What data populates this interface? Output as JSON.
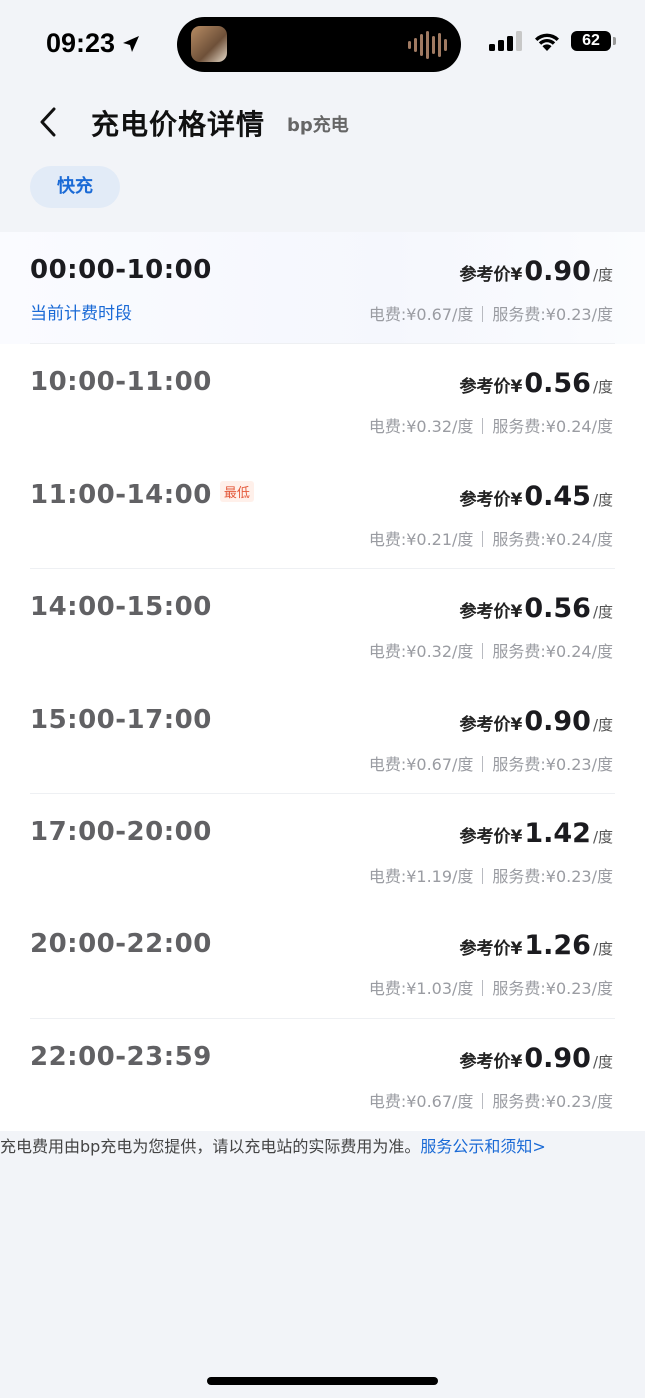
{
  "status_bar": {
    "time": "09:23",
    "battery": "62"
  },
  "header": {
    "title": "充电价格详情",
    "subtitle": "bp充电"
  },
  "tabs": {
    "active_label": "快充"
  },
  "labels": {
    "ref_price": "参考价¥",
    "unit": "/度",
    "current_period": "当前计费时段",
    "lowest_tag": "最低"
  },
  "periods": [
    {
      "period": "00:00-10:00",
      "price": "0.90",
      "electricity": "电费:¥0.67/度",
      "service": "服务费:¥0.23/度"
    },
    {
      "period": "10:00-11:00",
      "price": "0.56",
      "electricity": "电费:¥0.32/度",
      "service": "服务费:¥0.24/度"
    },
    {
      "period": "11:00-14:00",
      "price": "0.45",
      "electricity": "电费:¥0.21/度",
      "service": "服务费:¥0.24/度"
    },
    {
      "period": "14:00-15:00",
      "price": "0.56",
      "electricity": "电费:¥0.32/度",
      "service": "服务费:¥0.24/度"
    },
    {
      "period": "15:00-17:00",
      "price": "0.90",
      "electricity": "电费:¥0.67/度",
      "service": "服务费:¥0.23/度"
    },
    {
      "period": "17:00-20:00",
      "price": "1.42",
      "electricity": "电费:¥1.19/度",
      "service": "服务费:¥0.23/度"
    },
    {
      "period": "20:00-22:00",
      "price": "1.26",
      "electricity": "电费:¥1.03/度",
      "service": "服务费:¥0.23/度"
    },
    {
      "period": "22:00-23:59",
      "price": "0.90",
      "electricity": "电费:¥0.67/度",
      "service": "服务费:¥0.23/度"
    }
  ],
  "footer": {
    "note": "充电费用由bp充电为您提供，请以充电站的实际费用为准。",
    "link": "服务公示和须知>"
  }
}
